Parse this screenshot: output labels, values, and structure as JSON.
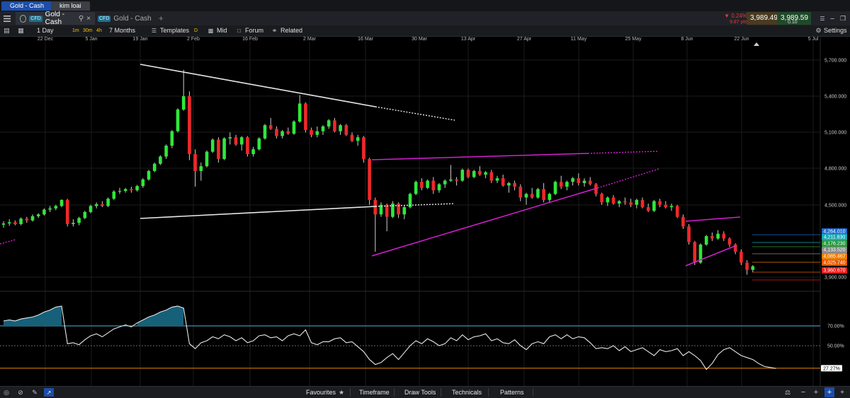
{
  "window_tabs": [
    {
      "label": "Gold - Cash"
    },
    {
      "label": "kim loai"
    }
  ],
  "instrument_tabs": [
    {
      "badge": "CFD",
      "label": "Gold - Cash"
    },
    {
      "badge": "CFD",
      "label": "Gold - Cash"
    }
  ],
  "quote": {
    "change_pct": "0.24%",
    "change_pts": "9.87 pts",
    "sell": "3,989.49",
    "spread": "0.10",
    "buy": "3,989.59",
    "down_color": "#e23b3b",
    "up_color": "#2fae3f"
  },
  "toolbar": {
    "period": "1 Day",
    "intervals": [
      "1m",
      "30m",
      "4h",
      "D"
    ],
    "range": "7 Months",
    "templates": "Templates",
    "price_mode": "Mid",
    "forum": "Forum",
    "related": "Related",
    "settings": "Settings"
  },
  "chart_data": {
    "type": "candlestick",
    "x_ticks": [
      "22 Dec",
      "5 Jan",
      "19 Jan",
      "2 Feb",
      "16 Feb",
      "2 Mar",
      "16 Mar",
      "30 Mar",
      "13 Apr",
      "27 Apr",
      "11 May",
      "25 May",
      "8 Jun",
      "22 Jun",
      "5 Jul"
    ],
    "y_ticks": [
      "5,700.000",
      "5,400.000",
      "5,100.000",
      "4,800.000",
      "4,500.000",
      "3,900.000"
    ],
    "y_range": [
      3900,
      5800
    ],
    "price_tags": [
      {
        "label": "4,264.010",
        "color": "#1e6bd6"
      },
      {
        "label": "4,211.830",
        "color": "#1aa7b5"
      },
      {
        "label": "4,176.230",
        "color": "#2a9b3a"
      },
      {
        "label": "4,133.520",
        "color": "#8a8a8a"
      },
      {
        "label": "4,085.467",
        "color": "#ef7d00"
      },
      {
        "label": "4,025.740",
        "color": "#e35a00"
      },
      {
        "label": "3,960.670",
        "color": "#e31d1d"
      }
    ],
    "series": [
      {
        "name": "Gold - Cash",
        "candles": [
          [
            4335,
            4365,
            4310,
            4345
          ],
          [
            4345,
            4380,
            4325,
            4355
          ],
          [
            4355,
            4370,
            4330,
            4340
          ],
          [
            4340,
            4395,
            4330,
            4385
          ],
          [
            4385,
            4400,
            4350,
            4370
          ],
          [
            4370,
            4420,
            4360,
            4405
          ],
          [
            4405,
            4430,
            4390,
            4420
          ],
          [
            4420,
            4470,
            4410,
            4460
          ],
          [
            4460,
            4490,
            4440,
            4470
          ],
          [
            4470,
            4500,
            4455,
            4490
          ],
          [
            4490,
            4545,
            4480,
            4540
          ],
          [
            4540,
            4550,
            4320,
            4340
          ],
          [
            4340,
            4380,
            4320,
            4350
          ],
          [
            4350,
            4400,
            4330,
            4390
          ],
          [
            4390,
            4450,
            4380,
            4440
          ],
          [
            4440,
            4500,
            4430,
            4490
          ],
          [
            4490,
            4520,
            4470,
            4505
          ],
          [
            4505,
            4530,
            4480,
            4490
          ],
          [
            4490,
            4560,
            4480,
            4550
          ],
          [
            4550,
            4620,
            4540,
            4610
          ],
          [
            4610,
            4640,
            4590,
            4615
          ],
          [
            4615,
            4640,
            4600,
            4630
          ],
          [
            4630,
            4650,
            4600,
            4620
          ],
          [
            4620,
            4665,
            4610,
            4655
          ],
          [
            4655,
            4720,
            4640,
            4710
          ],
          [
            4710,
            4790,
            4700,
            4780
          ],
          [
            4780,
            4850,
            4770,
            4840
          ],
          [
            4840,
            4910,
            4830,
            4900
          ],
          [
            4900,
            5000,
            4880,
            4990
          ],
          [
            4990,
            5120,
            4970,
            5110
          ],
          [
            5110,
            5300,
            5100,
            5290
          ],
          [
            5290,
            5620,
            5280,
            5400
          ],
          [
            5400,
            5440,
            4870,
            4920
          ],
          [
            4920,
            4960,
            4650,
            4780
          ],
          [
            4780,
            4850,
            4700,
            4820
          ],
          [
            4820,
            4950,
            4810,
            4940
          ],
          [
            4940,
            5050,
            4930,
            5040
          ],
          [
            5040,
            5060,
            4850,
            4880
          ],
          [
            4880,
            5060,
            4870,
            5050
          ],
          [
            5050,
            5100,
            5000,
            5060
          ],
          [
            5060,
            5080,
            4990,
            5000
          ],
          [
            5000,
            5070,
            4950,
            5060
          ],
          [
            5060,
            5070,
            4900,
            4920
          ],
          [
            4920,
            4980,
            4900,
            4960
          ],
          [
            4960,
            5060,
            4950,
            5050
          ],
          [
            5050,
            5170,
            5040,
            5160
          ],
          [
            5160,
            5220,
            5120,
            5130
          ],
          [
            5130,
            5150,
            5050,
            5070
          ],
          [
            5070,
            5120,
            5050,
            5110
          ],
          [
            5110,
            5140,
            5080,
            5090
          ],
          [
            5090,
            5200,
            5080,
            5190
          ],
          [
            5190,
            5410,
            5180,
            5340
          ],
          [
            5340,
            5350,
            5100,
            5120
          ],
          [
            5120,
            5140,
            5060,
            5080
          ],
          [
            5080,
            5150,
            5060,
            5110
          ],
          [
            5110,
            5160,
            5080,
            5150
          ],
          [
            5150,
            5210,
            5130,
            5200
          ],
          [
            5200,
            5220,
            5100,
            5110
          ],
          [
            5110,
            5170,
            5080,
            5160
          ],
          [
            5160,
            5170,
            5070,
            5080
          ],
          [
            5080,
            5100,
            5020,
            5030
          ],
          [
            5030,
            5080,
            4990,
            5060
          ],
          [
            5060,
            5070,
            4850,
            4880
          ],
          [
            4880,
            4890,
            4500,
            4540
          ],
          [
            4540,
            4560,
            4110,
            4420
          ],
          [
            4420,
            4520,
            4400,
            4500
          ],
          [
            4500,
            4510,
            4280,
            4400
          ],
          [
            4400,
            4530,
            4390,
            4510
          ],
          [
            4510,
            4520,
            4390,
            4420
          ],
          [
            4420,
            4490,
            4380,
            4480
          ],
          [
            4480,
            4600,
            4470,
            4590
          ],
          [
            4590,
            4700,
            4580,
            4690
          ],
          [
            4690,
            4720,
            4620,
            4640
          ],
          [
            4640,
            4710,
            4630,
            4700
          ],
          [
            4700,
            4730,
            4590,
            4620
          ],
          [
            4620,
            4680,
            4600,
            4670
          ],
          [
            4670,
            4710,
            4640,
            4700
          ],
          [
            4700,
            4830,
            4690,
            4710
          ],
          [
            4710,
            4730,
            4660,
            4700
          ],
          [
            4700,
            4800,
            4690,
            4790
          ],
          [
            4790,
            4800,
            4720,
            4730
          ],
          [
            4730,
            4790,
            4720,
            4780
          ],
          [
            4780,
            4820,
            4740,
            4750
          ],
          [
            4750,
            4780,
            4720,
            4770
          ],
          [
            4770,
            4790,
            4680,
            4700
          ],
          [
            4700,
            4740,
            4680,
            4720
          ],
          [
            4720,
            4750,
            4650,
            4660
          ],
          [
            4660,
            4690,
            4600,
            4680
          ],
          [
            4680,
            4700,
            4620,
            4650
          ],
          [
            4650,
            4670,
            4530,
            4560
          ],
          [
            4560,
            4600,
            4500,
            4590
          ],
          [
            4590,
            4640,
            4550,
            4560
          ],
          [
            4560,
            4640,
            4550,
            4630
          ],
          [
            4630,
            4680,
            4520,
            4540
          ],
          [
            4540,
            4600,
            4520,
            4590
          ],
          [
            4590,
            4700,
            4580,
            4690
          ],
          [
            4690,
            4740,
            4630,
            4650
          ],
          [
            4650,
            4700,
            4620,
            4690
          ],
          [
            4690,
            4730,
            4660,
            4720
          ],
          [
            4720,
            4760,
            4660,
            4680
          ],
          [
            4680,
            4720,
            4650,
            4700
          ],
          [
            4700,
            4730,
            4660,
            4670
          ],
          [
            4670,
            4680,
            4570,
            4590
          ],
          [
            4590,
            4600,
            4500,
            4520
          ],
          [
            4520,
            4570,
            4490,
            4560
          ],
          [
            4560,
            4580,
            4500,
            4510
          ],
          [
            4510,
            4540,
            4480,
            4530
          ],
          [
            4530,
            4560,
            4500,
            4520
          ],
          [
            4520,
            4550,
            4480,
            4500
          ],
          [
            4500,
            4550,
            4470,
            4540
          ],
          [
            4540,
            4560,
            4470,
            4480
          ],
          [
            4480,
            4510,
            4440,
            4450
          ],
          [
            4450,
            4540,
            4440,
            4530
          ],
          [
            4530,
            4550,
            4480,
            4500
          ],
          [
            4500,
            4530,
            4470,
            4480
          ],
          [
            4480,
            4510,
            4450,
            4490
          ],
          [
            4490,
            4500,
            4390,
            4400
          ],
          [
            4400,
            4420,
            4300,
            4320
          ],
          [
            4320,
            4340,
            4170,
            4190
          ],
          [
            4190,
            4200,
            4000,
            4020
          ],
          [
            4020,
            4180,
            4010,
            4170
          ],
          [
            4170,
            4250,
            4160,
            4240
          ],
          [
            4240,
            4270,
            4200,
            4220
          ],
          [
            4220,
            4290,
            4210,
            4260
          ],
          [
            4260,
            4280,
            4200,
            4220
          ],
          [
            4220,
            4230,
            4150,
            4170
          ],
          [
            4170,
            4180,
            4090,
            4110
          ],
          [
            4110,
            4130,
            4000,
            4020
          ],
          [
            4020,
            4040,
            3920,
            3960
          ],
          [
            3960,
            4000,
            3940,
            3990
          ]
        ]
      },
      {
        "name": "Oscillator",
        "values": [
          75,
          76,
          75,
          77,
          78,
          79,
          81,
          84,
          86,
          89,
          90,
          52,
          53,
          51,
          56,
          60,
          62,
          59,
          63,
          67,
          69,
          71,
          69,
          73,
          76,
          79,
          81,
          84,
          86,
          89,
          90,
          88,
          52,
          47,
          53,
          55,
          59,
          57,
          61,
          59,
          55,
          58,
          53,
          55,
          60,
          61,
          58,
          59,
          55,
          60,
          62,
          60,
          66,
          53,
          51,
          54,
          54,
          57,
          58,
          53,
          54,
          49,
          44,
          36,
          31,
          33,
          38,
          42,
          36,
          43,
          50,
          55,
          52,
          57,
          54,
          50,
          52,
          58,
          55,
          61,
          56,
          59,
          60,
          62,
          55,
          57,
          53,
          52,
          56,
          50,
          46,
          52,
          54,
          52,
          59,
          61,
          57,
          61,
          57,
          59,
          58,
          53,
          47,
          48,
          47,
          50,
          45,
          49,
          44,
          46,
          48,
          44,
          40,
          46,
          44,
          45,
          47,
          40,
          44,
          40,
          35,
          26,
          32,
          41,
          46,
          48,
          44,
          40,
          38,
          36,
          32,
          29,
          28,
          27
        ]
      }
    ],
    "oscillator": {
      "levels": [
        "70.00%",
        "50.00%",
        "27.27%"
      ]
    }
  },
  "bottombar": {
    "favourites": "Favourites",
    "timeframe": "Timeframe",
    "draw_tools": "Draw Tools",
    "technicals": "Technicals",
    "patterns": "Patterns"
  }
}
